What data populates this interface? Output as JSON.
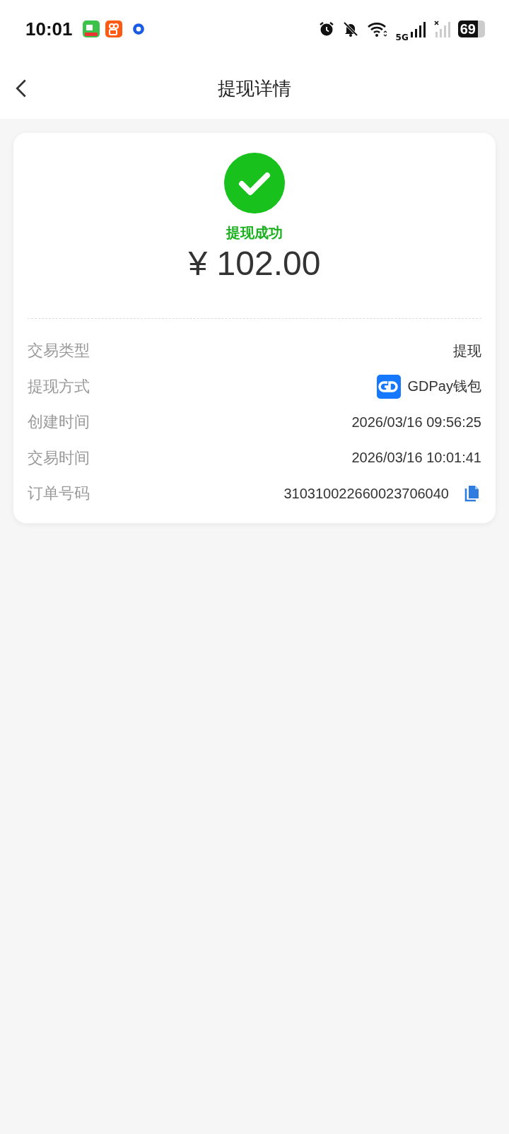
{
  "status_bar": {
    "time": "10:01",
    "network": "5G",
    "battery": "69"
  },
  "header": {
    "title": "提现详情"
  },
  "result": {
    "status": "提现成功",
    "success": true,
    "amount": "¥ 102.00"
  },
  "details": [
    {
      "kind": "text",
      "label": "交易类型",
      "value": "提现"
    },
    {
      "kind": "wallet",
      "label": "提现方式",
      "value": "GDPay钱包"
    },
    {
      "kind": "text",
      "label": "创建时间",
      "value": "2026/03/16 09:56:25"
    },
    {
      "kind": "text",
      "label": "交易时间",
      "value": "2026/03/16 10:01:41"
    },
    {
      "kind": "copy",
      "label": "订单号码",
      "value": "310310022660023706040"
    }
  ]
}
